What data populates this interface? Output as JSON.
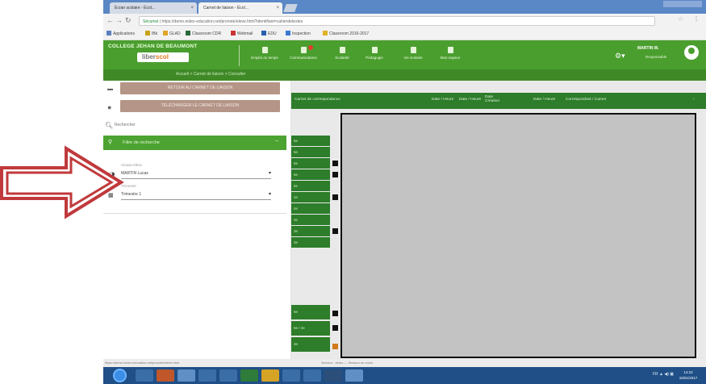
{
  "browser": {
    "tabs": [
      {
        "label": "Écran scolaire - Écol..."
      },
      {
        "label": "Carnet de liaison - Écol..."
      }
    ],
    "url_secure": "Sécurisé",
    "url": "https://demo.index-education.net/pronote/eleve.html?identifiant=cahierdetextes",
    "bookmarks": [
      "Applications",
      "IBk",
      "GLAD",
      "Classroom CDR",
      "Webmail",
      "EDU",
      "Inspection",
      "Classroom 2016-2017"
    ]
  },
  "header": {
    "school_name": "COLLEGE JEHAN DE BEAUMONT",
    "brand_main": "liber",
    "brand_sub": "scol",
    "nav": [
      {
        "label": "Emploi du temps",
        "icon": "calendar-icon"
      },
      {
        "label": "Communications",
        "icon": "mail-icon"
      },
      {
        "label": "Scolarité",
        "icon": "school-icon"
      },
      {
        "label": "Pédagogie",
        "icon": "book-icon"
      },
      {
        "label": "Vie scolaire",
        "icon": "chat-icon"
      },
      {
        "label": "Mon espace",
        "icon": "user-icon"
      }
    ],
    "user_name": "MARTIN M.",
    "user_role": "Responsable"
  },
  "breadcrumb": "Accueil  >  Carnet de liaison  >  Consulter",
  "sidebar": {
    "button_1": "RETOUR AU CARNET DE LIAISON",
    "button_2": "TÉLÉCHARGER LE CARNET DE LIAISON",
    "search_placeholder": "Rechercher",
    "filter_title": "Filtre de recherche",
    "filter_toggle": "−",
    "field_1_caption": "Classe-élève",
    "field_1_value": "MARTIN Lucas",
    "field_2_caption": "Trimestre",
    "field_2_value": "Trimestre 1"
  },
  "table": {
    "header": [
      "Carnet de correspondance",
      "Date / Heure",
      "Date / Heure",
      "Date Création",
      "Date / Heure",
      "Correspondant / Carnet"
    ],
    "rows": [
      "6e",
      "6e",
      "5e",
      "5e",
      "5e",
      "4e",
      "4e",
      "3e",
      "3e",
      "3e"
    ],
    "rows_bottom": [
      "6e",
      "5e / 4e",
      "3e"
    ]
  },
  "status": {
    "left": "https://demo.index-education.net/pronote/eleve.html",
    "middle": "Serveur : demo — Session en cours"
  },
  "taskbar": {
    "tray": "FR  ▲  ◀)  ▣",
    "time": "14:22",
    "date": "15/01/2017"
  }
}
